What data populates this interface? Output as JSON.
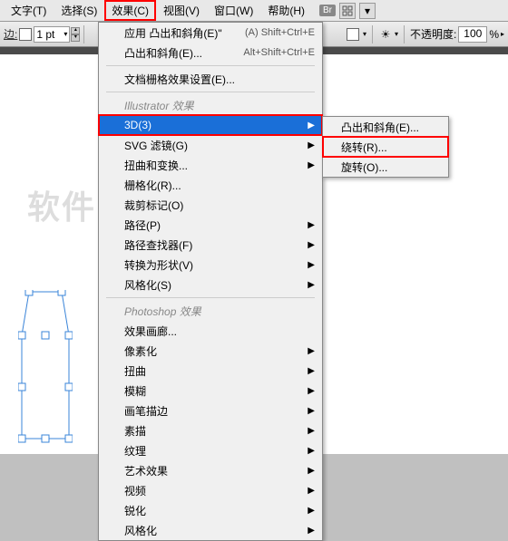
{
  "menubar": {
    "items": [
      {
        "label": "文字(T)"
      },
      {
        "label": "选择(S)"
      },
      {
        "label": "效果(C)",
        "highlighted": true
      },
      {
        "label": "视图(V)"
      },
      {
        "label": "窗口(W)"
      },
      {
        "label": "帮助(H)"
      }
    ],
    "br": "Br"
  },
  "toolbar": {
    "stroke_label": "边:",
    "pt_value": "1 pt",
    "opacity_label": "不透明度:",
    "opacity_value": "100",
    "percent": "%"
  },
  "dropdown": {
    "top": [
      {
        "label": "应用 凸出和斜角(E)\"",
        "shortcut": "(A)  Shift+Ctrl+E"
      },
      {
        "label": "凸出和斜角(E)...",
        "shortcut": "Alt+Shift+Ctrl+E"
      }
    ],
    "raster": {
      "label": "文档栅格效果设置(E)..."
    },
    "header1": "Illustrator 效果",
    "ai_items": [
      {
        "label": "3D(3)",
        "arrow": true,
        "selected": true,
        "boxed": true
      },
      {
        "label": "SVG 滤镜(G)",
        "arrow": true
      },
      {
        "label": "扭曲和变换...",
        "arrow": true
      },
      {
        "label": "栅格化(R)..."
      },
      {
        "label": "裁剪标记(O)"
      },
      {
        "label": "路径(P)",
        "arrow": true
      },
      {
        "label": "路径查找器(F)",
        "arrow": true
      },
      {
        "label": "转换为形状(V)",
        "arrow": true
      },
      {
        "label": "风格化(S)",
        "arrow": true
      }
    ],
    "header2": "Photoshop 效果",
    "ps_items": [
      {
        "label": "效果画廊..."
      },
      {
        "label": "像素化",
        "arrow": true
      },
      {
        "label": "扭曲",
        "arrow": true
      },
      {
        "label": "模糊",
        "arrow": true
      },
      {
        "label": "画笔描边",
        "arrow": true
      },
      {
        "label": "素描",
        "arrow": true
      },
      {
        "label": "纹理",
        "arrow": true
      },
      {
        "label": "艺术效果",
        "arrow": true
      },
      {
        "label": "视频",
        "arrow": true
      },
      {
        "label": "锐化",
        "arrow": true
      },
      {
        "label": "风格化",
        "arrow": true
      }
    ]
  },
  "submenu": {
    "items": [
      {
        "label": "凸出和斜角(E)..."
      },
      {
        "label": "绕转(R)...",
        "boxed": true
      },
      {
        "label": "旋转(O)..."
      }
    ]
  },
  "watermark": "软件自学网"
}
